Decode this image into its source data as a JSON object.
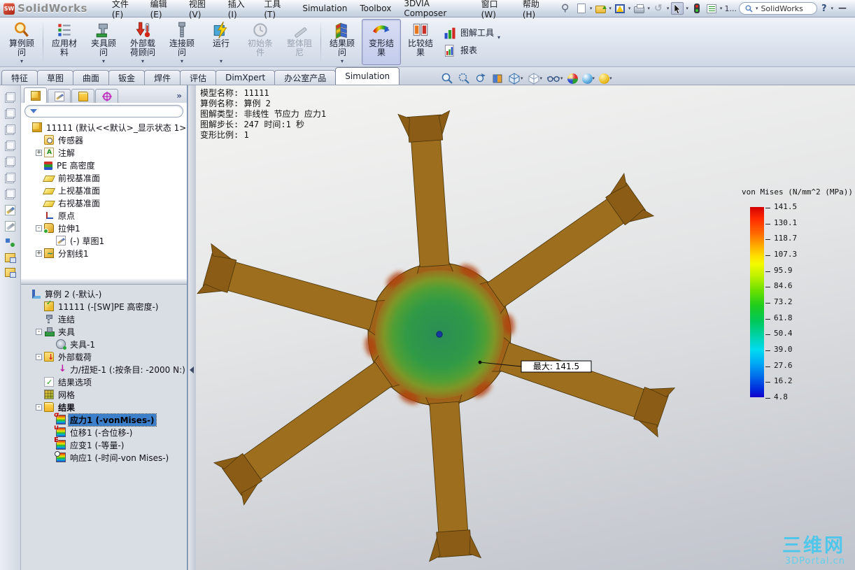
{
  "window": {
    "logo": "SW",
    "title": "SolidWorks",
    "minimize": "—",
    "help": "?"
  },
  "menu": {
    "items": [
      "文件(F)",
      "编辑(E)",
      "视图(V)",
      "插入(I)",
      "工具(T)",
      "Simulation",
      "Toolbox",
      "3DVIA Composer",
      "窗口(W)",
      "帮助(H)"
    ]
  },
  "quickbar": {
    "docs": "1...",
    "search": "SolidWorks"
  },
  "ribbon": {
    "buttons": [
      {
        "label": "算例顾问",
        "dropdown": "▾"
      },
      {
        "label": "应用材料",
        "dropdown": ""
      },
      {
        "label": "夹具顾问",
        "dropdown": "▾"
      },
      {
        "label": "外部载荷顾问",
        "dropdown": "▾"
      },
      {
        "label": "连接顾问",
        "dropdown": "▾"
      },
      {
        "label": "运行",
        "dropdown": "▾"
      },
      {
        "label": "初始条件",
        "dropdown": ""
      },
      {
        "label": "整体阻尼",
        "dropdown": ""
      },
      {
        "label": "结果顾问",
        "dropdown": "▾"
      },
      {
        "label": "变形结果",
        "dropdown": ""
      },
      {
        "label": "比较结果",
        "dropdown": ""
      },
      {
        "label": "图解工具",
        "dropdown": "▾"
      },
      {
        "label": "报表",
        "dropdown": ""
      }
    ]
  },
  "tabs": {
    "items": [
      "特征",
      "草图",
      "曲面",
      "钣金",
      "焊件",
      "评估",
      "DimXpert",
      "办公室产品",
      "Simulation"
    ]
  },
  "feature_tree": {
    "items": [
      {
        "exp": "",
        "label": "11111    (默认<<默认>_显示状态 1>)"
      },
      {
        "exp": "",
        "label": "传感器"
      },
      {
        "exp": "+",
        "label": "注解"
      },
      {
        "exp": "",
        "label": "PE 高密度"
      },
      {
        "exp": "",
        "label": "前视基准面"
      },
      {
        "exp": "",
        "label": "上视基准面"
      },
      {
        "exp": "",
        "label": "右视基准面"
      },
      {
        "exp": "",
        "label": "原点"
      },
      {
        "exp": "-",
        "label": "拉伸1"
      },
      {
        "exp": "",
        "label": "(-) 草图1"
      },
      {
        "exp": "+",
        "label": "分割线1"
      }
    ]
  },
  "sim_tree": {
    "items": [
      {
        "exp": "",
        "label": "算例 2 (-默认-)"
      },
      {
        "exp": "",
        "label": "11111 (-[SW]PE 高密度-)"
      },
      {
        "exp": "",
        "label": "连结"
      },
      {
        "exp": "-",
        "label": "夹具"
      },
      {
        "exp": "",
        "label": "夹具-1"
      },
      {
        "exp": "-",
        "label": "外部载荷"
      },
      {
        "exp": "",
        "label": "力/扭矩-1 (:按条目: -2000 N:)"
      },
      {
        "exp": "",
        "label": "结果选项"
      },
      {
        "exp": "",
        "label": "网格"
      },
      {
        "exp": "-",
        "label": "结果"
      },
      {
        "exp": "",
        "label": "应力1 (-vonMises-)"
      },
      {
        "exp": "",
        "label": "位移1 (-合位移-)"
      },
      {
        "exp": "",
        "label": "应变1 (-等量-)"
      },
      {
        "exp": "",
        "label": "响应1 (-时间-von Mises-)"
      }
    ]
  },
  "viewport": {
    "annotation_lines": [
      "模型名称: 11111",
      "算例名称: 算例 2",
      "图解类型: 非线性 节应力 应力1",
      "图解步长: 247    时间:1 秒",
      "变形比例: 1"
    ],
    "max_callout": "最大:  141.5"
  },
  "legend": {
    "title": "von Mises (N/mm^2 (MPa))",
    "values": [
      "141.5",
      "130.1",
      "118.7",
      "107.3",
      "95.9",
      "84.6",
      "73.2",
      "61.8",
      "50.4",
      "39.0",
      "27.6",
      "16.2",
      "4.8"
    ]
  },
  "watermark": {
    "line1": "三维网",
    "line2": "3DPortal.cn"
  },
  "colors": {
    "selection": "#3c80cc",
    "active_button_bg": "#ccd3ee",
    "arm_olive": "#9c6e1e",
    "arm_tip_brown": "#8a5c16",
    "hub_green": "#2f9a47",
    "hotspot_red": "#b04010",
    "center_dot_blue": "#15379e",
    "legend_top": "#d40000",
    "legend_bottom": "#1400c8",
    "watermark_cyan": "#39c6ee"
  }
}
